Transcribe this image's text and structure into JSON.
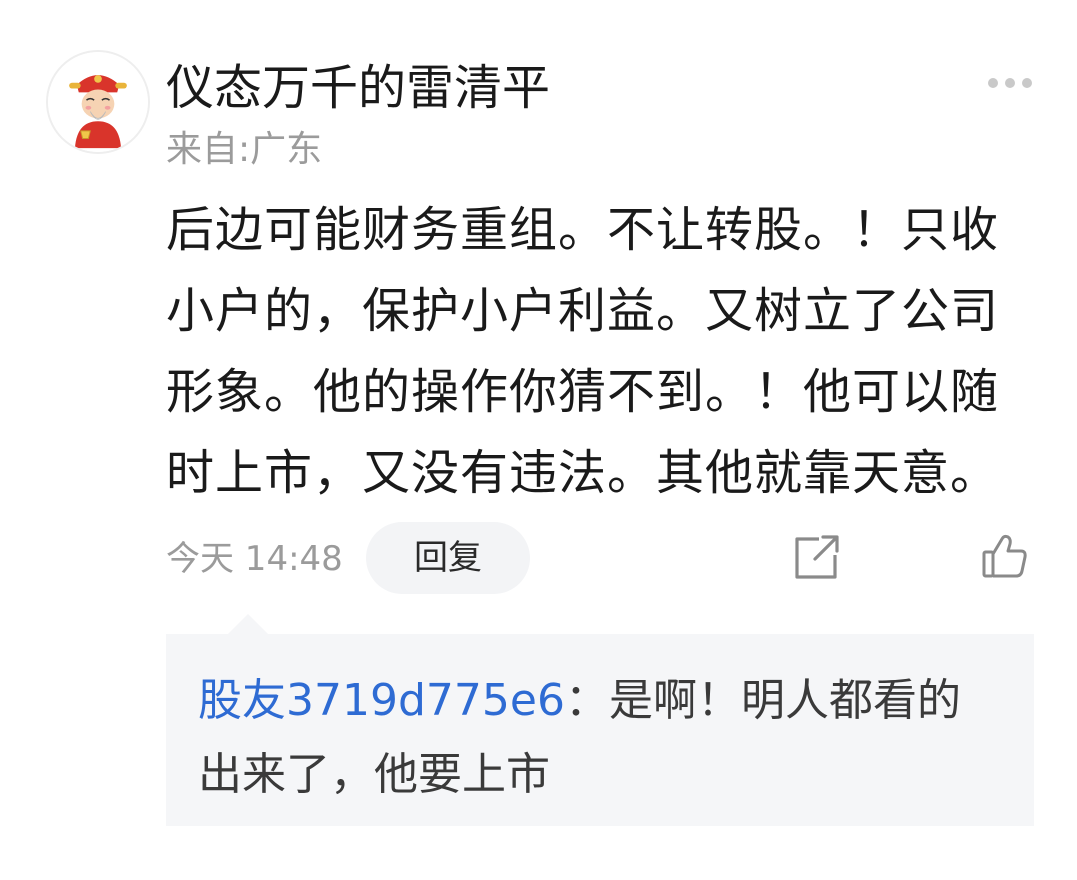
{
  "post": {
    "username": "仪态万千的雷清平",
    "location": "来自:广东",
    "content": "后边可能财务重组。不让转股。！只收\n小户的，保护小户利益。又树立了公司\n形象。他的操作你猜不到。！他可以随\n时上市，又没有违法。其他就靠天意。",
    "time": "今天 14:48",
    "reply_label": "回复",
    "icons": [
      "more-icon",
      "share-icon",
      "thumbs-up-icon"
    ],
    "avatar_icon": "avatar-caishen"
  },
  "reply": {
    "user": "股友3719d775e6",
    "text": "：是啊！明人都看的出来了，他要上市"
  },
  "colors": {
    "link_blue": "#2e6bd3",
    "secondary_gray": "#9b9b9b",
    "reply_bg": "#f5f6f8",
    "button_bg": "#f3f4f6"
  }
}
